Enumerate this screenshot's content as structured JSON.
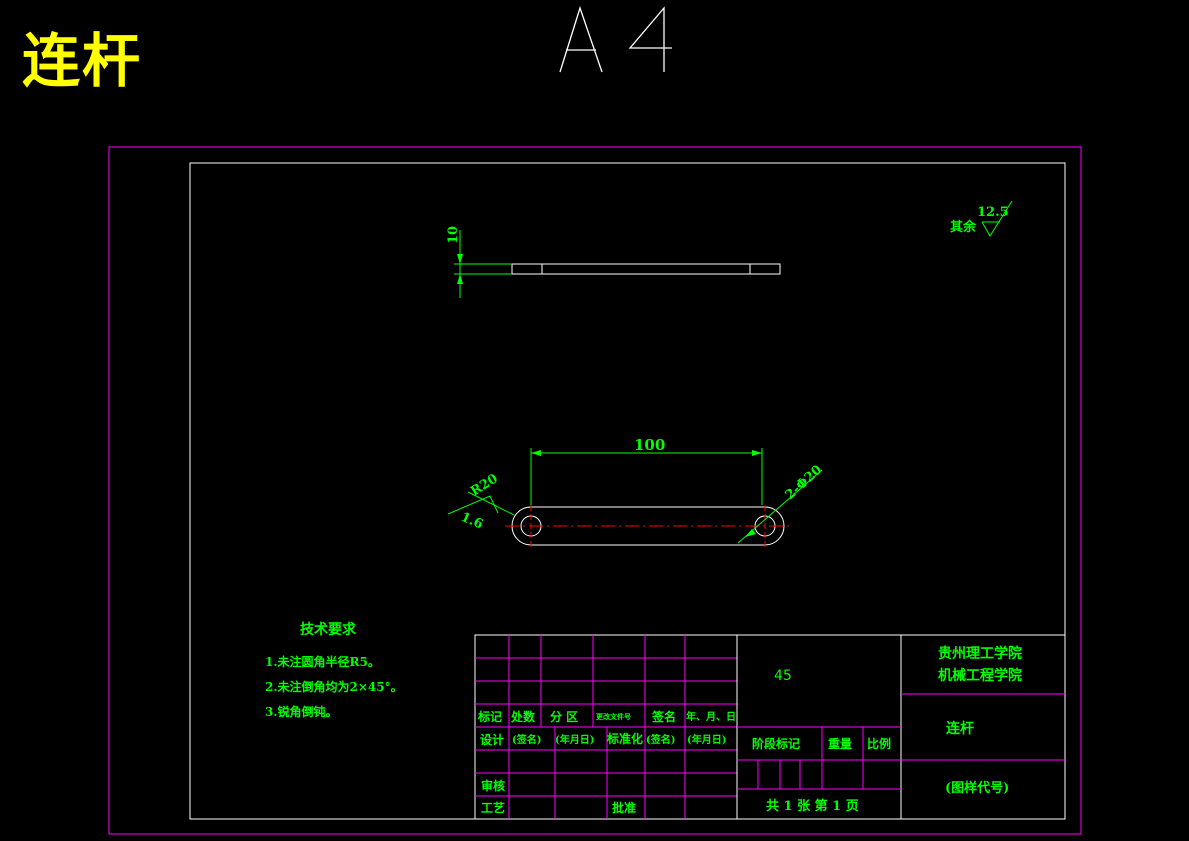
{
  "title_cn": "连杆",
  "sheet_size": "A4",
  "drawing": {
    "surface_roughness_label": "其余",
    "surface_roughness_value": "12.5",
    "thickness_dim": "10",
    "center_distance_dim": "100",
    "radius_dim": "R20",
    "hole_dim": "2-Φ20",
    "local_roughness": "1.6"
  },
  "tech_requirements": {
    "heading": "技术要求",
    "items": [
      "1.未注圆角半径R5。",
      "2.未注倒角均为2×45°。",
      "3.锐角倒钝。"
    ]
  },
  "title_block": {
    "material": "45",
    "school_line1": "贵州理工学院",
    "school_line2": "机械工程学院",
    "part_name": "连杆",
    "drawing_code": "(图样代号)",
    "sheet_info": "共 1 张  第 1 页",
    "hdr_biaoji": "标记",
    "hdr_chushu": "处数",
    "hdr_fenqu": "分 区",
    "hdr_gengai": "更改文件号",
    "hdr_qianming": "签名",
    "hdr_date": "年、月、日",
    "row_sheji": "设计",
    "row_qianming1": "(签名)",
    "row_date1": "(年月日)",
    "row_biaozhunhua": "标准化",
    "row_qianming2": "(签名)",
    "row_date2": "(年月日)",
    "hdr_jieduan": "阶段标记",
    "hdr_zhongliang": "重量",
    "hdr_bili": "比例",
    "row_shenhe": "审核",
    "row_gongyi": "工艺",
    "row_pizhun": "批准"
  }
}
